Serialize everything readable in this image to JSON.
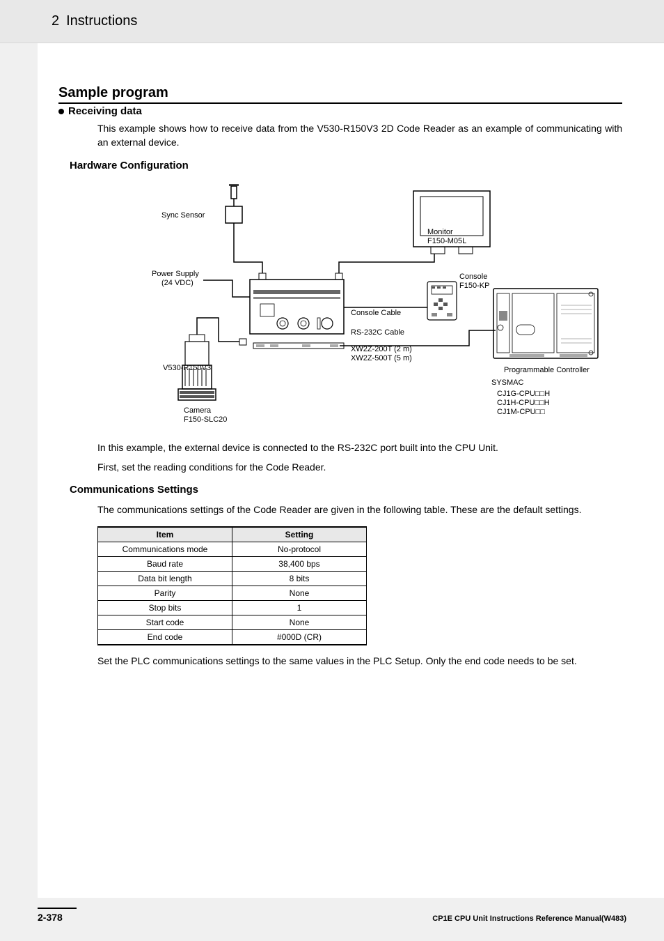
{
  "header": {
    "num": "2",
    "title": "Instructions"
  },
  "h1": "Sample program",
  "bullet": "Receiving data",
  "intro": "This example shows how to receive data from the V530-R150V3 2D Code Reader as an example of communicating with an external device.",
  "sub1": "Hardware Configuration",
  "diagram": {
    "syncSensor": "Sync Sensor",
    "powerSupply1": "Power Supply",
    "powerSupply2": "(24 VDC)",
    "monitor1": "Monitor",
    "monitor2": "F150-M05L",
    "console1": "Console",
    "console2": "F150-KP",
    "consoleCable": "Console Cable",
    "rs232": "RS-232C Cable",
    "xw1": "XW2Z-200T (2 m)",
    "xw2": "XW2Z-500T (5 m)",
    "v530": "V530-R150V3",
    "progCtrl": "Programmable Controller",
    "sysmac": "SYSMAC",
    "cj1": "CJ1G-CPU□□H",
    "cj2": "CJ1H-CPU□□H",
    "cj3": "CJ1M-CPU□□",
    "camera1": "Camera",
    "camera2": "F150-SLC20"
  },
  "afterDiagram1": "In this example, the external device is connected to the RS-232C port built into the CPU Unit.",
  "afterDiagram2": "First, set the reading conditions for the Code Reader.",
  "sub2": "Communications Settings",
  "commIntro": "The communications settings of the Code Reader are given in the following table. These are the default settings.",
  "table": {
    "headers": {
      "item": "Item",
      "setting": "Setting"
    },
    "rows": [
      {
        "item": "Communications mode",
        "setting": "No-protocol"
      },
      {
        "item": "Baud rate",
        "setting": "38,400 bps"
      },
      {
        "item": "Data bit length",
        "setting": "8 bits"
      },
      {
        "item": "Parity",
        "setting": "None"
      },
      {
        "item": "Stop bits",
        "setting": "1"
      },
      {
        "item": "Start code",
        "setting": "None"
      },
      {
        "item": "End code",
        "setting": "#000D (CR)"
      }
    ]
  },
  "afterTable": "Set the PLC communications settings to the same values in the PLC Setup. Only the end code needs to be set.",
  "footer": {
    "pageNum": "2-378",
    "manual": "CP1E CPU Unit Instructions Reference Manual(W483)"
  }
}
